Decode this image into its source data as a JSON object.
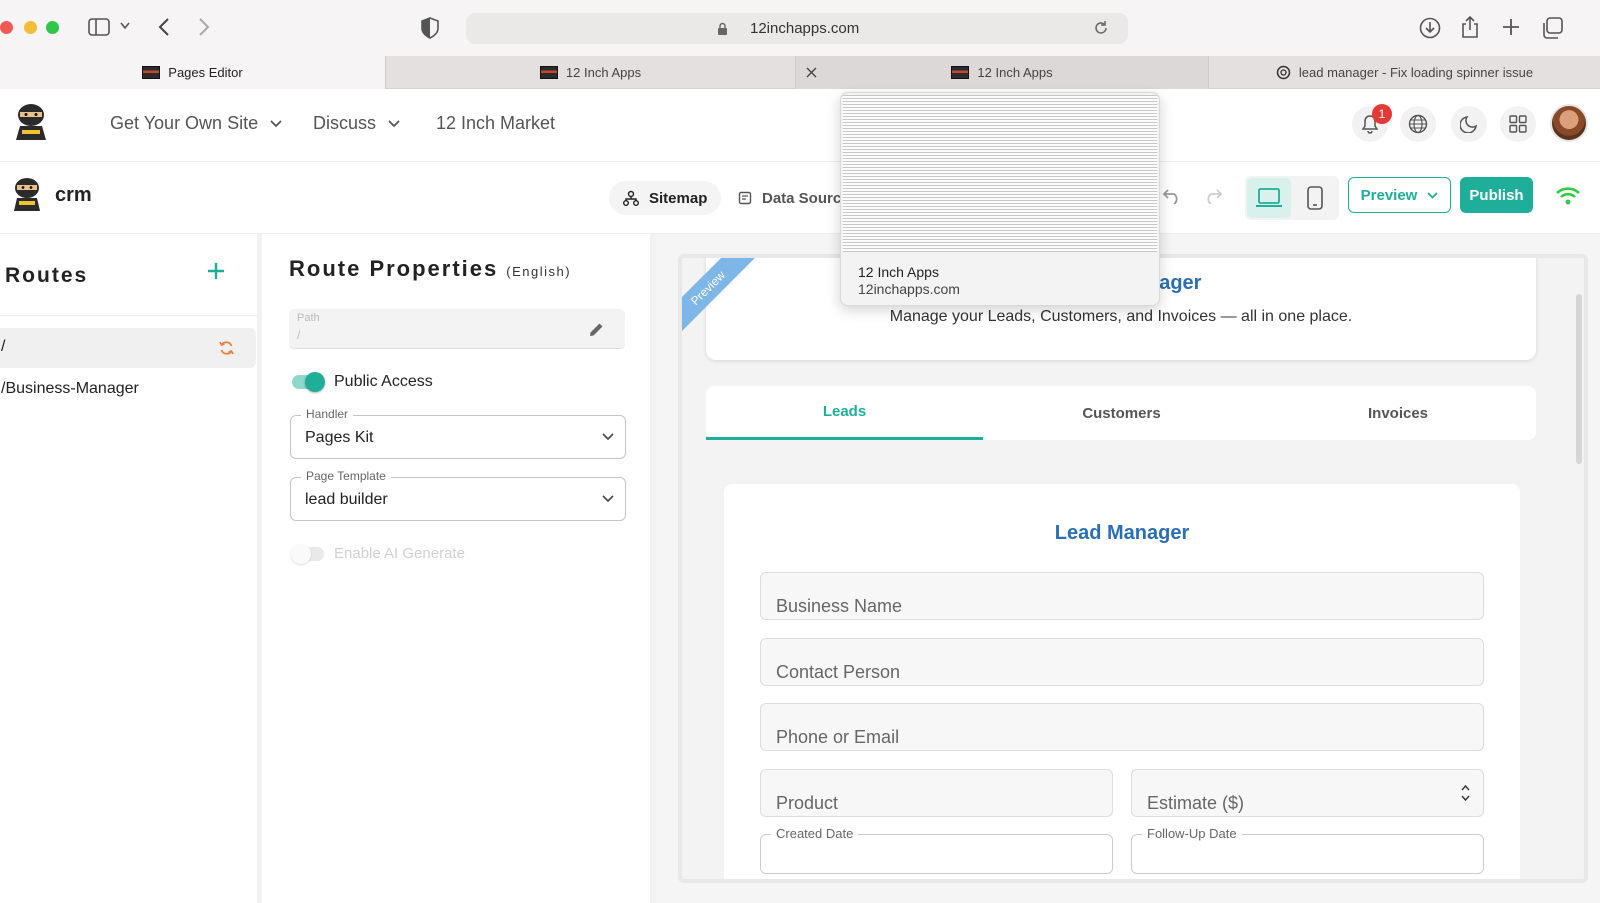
{
  "browser": {
    "url": "12inchapps.com",
    "tabs": [
      {
        "label": "Pages Editor"
      },
      {
        "label": "12 Inch Apps"
      },
      {
        "label": "12 Inch Apps"
      },
      {
        "label": "lead manager - Fix loading spinner issue"
      }
    ],
    "tab_preview": {
      "title": "12 Inch Apps",
      "url": "12inchapps.com"
    }
  },
  "header": {
    "nav": [
      {
        "label": "Get Your Own Site"
      },
      {
        "label": "Discuss"
      },
      {
        "label": "12 Inch Market"
      }
    ],
    "notification_count": "1"
  },
  "toolbar": {
    "app_name": "crm",
    "sitemap_label": "Sitemap",
    "data_sources_label": "Data Source",
    "preview_label": "Preview",
    "publish_label": "Publish"
  },
  "routes": {
    "title": "Routes",
    "items": [
      {
        "path": "/"
      },
      {
        "path": "/Business-Manager"
      }
    ]
  },
  "route_properties": {
    "title": "Route Properties",
    "language": "(English)",
    "path_label": "Path",
    "path_value": "/",
    "public_access_label": "Public Access",
    "public_access_enabled": true,
    "handler_label": "Handler",
    "handler_value": "Pages Kit",
    "template_label": "Page Template",
    "template_value": "lead builder",
    "ai_label": "Enable AI Generate",
    "ai_enabled": false
  },
  "preview": {
    "ribbon": "Preview",
    "hero_title_partial": "nager",
    "hero_subtitle": "Manage your Leads, Customers, and Invoices — all in one place.",
    "tabs": [
      {
        "label": "Leads"
      },
      {
        "label": "Customers"
      },
      {
        "label": "Invoices"
      }
    ],
    "active_tab": "Leads",
    "form_title": "Lead Manager",
    "fields": {
      "business_name": "Business Name",
      "contact_person": "Contact Person",
      "phone_or_email": "Phone or Email",
      "product": "Product",
      "estimate": "Estimate ($)",
      "created_date": "Created Date",
      "followup_date": "Follow-Up Date"
    }
  },
  "colors": {
    "accent": "#1fae9a",
    "brand_blue": "#2a6fb5",
    "badge_red": "#e53935",
    "wifi_green": "#2ecc40"
  }
}
